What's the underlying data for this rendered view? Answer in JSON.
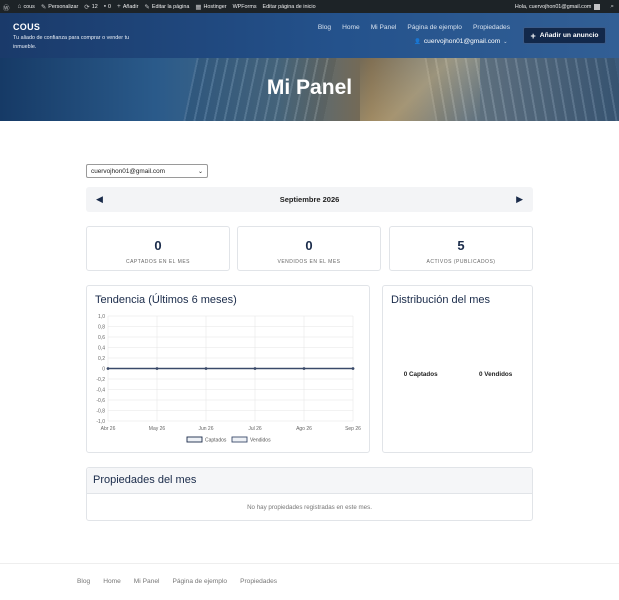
{
  "admin_bar": {
    "items": [
      {
        "icon": "wordpress-icon",
        "glyph": "Ⓦ",
        "label": ""
      },
      {
        "icon": "home-icon",
        "glyph": "⌂",
        "label": "cous"
      },
      {
        "icon": "brush-icon",
        "glyph": "✎",
        "label": "Personalizar"
      },
      {
        "icon": "updates-icon",
        "glyph": "⟳",
        "label": "12"
      },
      {
        "icon": "comments-icon",
        "glyph": "▪",
        "label": "0"
      },
      {
        "icon": "plus-icon",
        "glyph": "+",
        "label": "Añadir"
      },
      {
        "icon": "edit-icon",
        "glyph": "✎",
        "label": "Editar la página"
      },
      {
        "icon": "hostinger-icon",
        "glyph": "▦",
        "label": "Hostinger"
      },
      {
        "icon": "",
        "glyph": "",
        "label": "WPForms"
      },
      {
        "icon": "",
        "glyph": "",
        "label": "Editar página de inicio"
      }
    ],
    "greeting": "Hola, cuervojhon01@gmail.com",
    "search_glyph": "⌕"
  },
  "header": {
    "brand": "COUS",
    "tagline": "Tu aliado de confianza para comprar o vender tu inmueble.",
    "nav": [
      "Blog",
      "Home",
      "Mi Panel",
      "Página de ejemplo",
      "Propiedades"
    ],
    "user_email": "cuervojhon01@gmail.com",
    "user_glyph": "👤",
    "chevron_glyph": "⌄",
    "add_button": "Añadir un anuncio",
    "add_glyph": "+"
  },
  "hero": {
    "title": "Mi Panel"
  },
  "dashboard": {
    "user_select": "cuervojhon01@gmail.com",
    "select_chevron": "⌄",
    "month_label": "Septiembre 2026",
    "prev_glyph": "◀",
    "next_glyph": "▶",
    "stats": [
      {
        "value": "0",
        "label": "CAPTADOS EN EL MES"
      },
      {
        "value": "0",
        "label": "VENDIDOS EN EL MES"
      },
      {
        "value": "5",
        "label": "ACTIVOS (PUBLICADOS)"
      }
    ],
    "trend_title": "Tendencia (Últimos 6 meses)",
    "distribution_title": "Distribución del mes",
    "distribution": {
      "captados": "0 Captados",
      "vendidos": "0 Vendidos"
    },
    "properties_title": "Propiedades del mes",
    "properties_empty": "No hay propiedades registradas en este mes."
  },
  "chart_data": {
    "type": "line",
    "categories": [
      "Abr 26",
      "May 26",
      "Jun 26",
      "Jul 26",
      "Ago 26",
      "Sep 26"
    ],
    "series": [
      {
        "name": "Captados",
        "values": [
          0,
          0,
          0,
          0,
          0,
          0
        ],
        "color": "#1a2b4a"
      },
      {
        "name": "Vendidos",
        "values": [
          0,
          0,
          0,
          0,
          0,
          0
        ],
        "color": "#3a4a6a"
      }
    ],
    "y_ticks": [
      "1,0",
      "0,8",
      "0,6",
      "0,4",
      "0,2",
      "0",
      "-0,2",
      "-0,4",
      "-0,6",
      "-0,8",
      "-1,0"
    ],
    "ylim": [
      -1,
      1
    ],
    "grid": true,
    "legend": "bottom",
    "title": "Tendencia (Últimos 6 meses)"
  },
  "footer": {
    "nav": [
      "Blog",
      "Home",
      "Mi Panel",
      "Página de ejemplo",
      "Propiedades"
    ]
  }
}
